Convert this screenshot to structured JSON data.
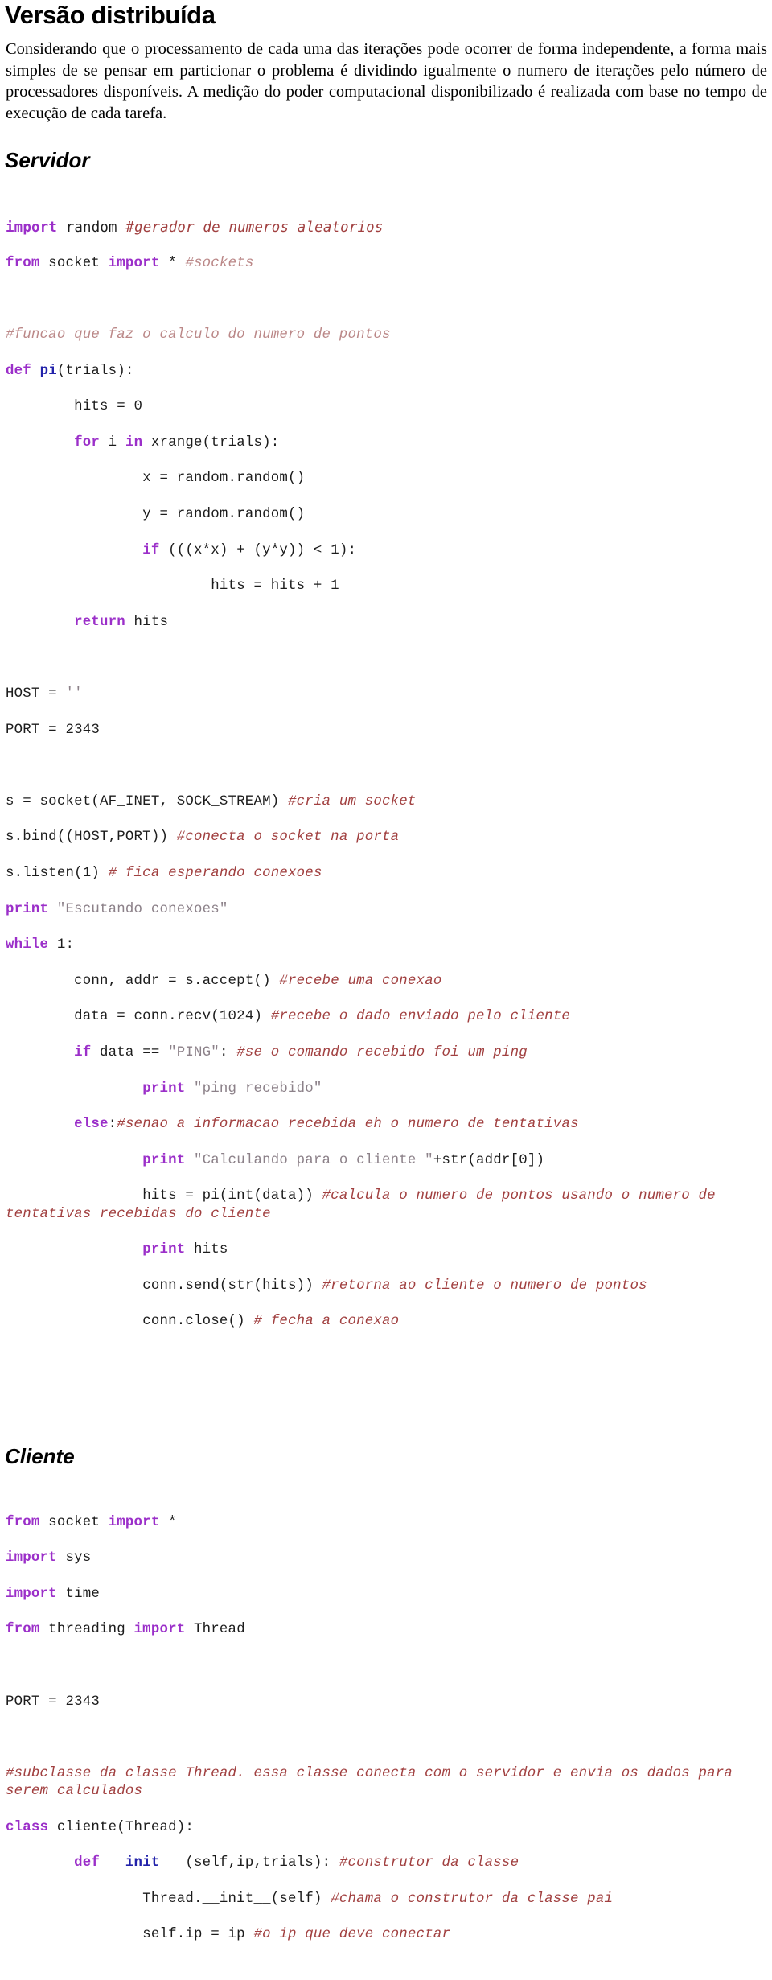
{
  "document": {
    "title": "Versão distribuída",
    "intro_paragraph": "Considerando que o processamento de cada uma das iterações pode ocorrer de forma independente, a forma mais simples de se pensar em particionar o problema é dividindo igualmente o numero de iterações pelo número de processadores disponíveis. A medição do poder computacional disponibilizado é realizada com base no tempo de execução de cada tarefa."
  },
  "sections": {
    "servidor": {
      "heading": "Servidor"
    },
    "cliente": {
      "heading": "Cliente"
    }
  },
  "code": {
    "servidor": {
      "l01_kw_import": "import",
      "l01_mod": " random ",
      "l01_comment": "#gerador de numeros aleatorios",
      "l02_kw_from": "from",
      "l02_mod": " socket ",
      "l02_kw_import": "import",
      "l02_star": " * ",
      "l02_comment": "#sockets",
      "l04_comment": "#funcao que faz o calculo do numero de pontos",
      "l05_kw_def": "def",
      "l05_name": "pi",
      "l05_rest": "(trials):",
      "l06": "        hits = 0",
      "l07_ind": "        ",
      "l07_kw_for": "for",
      "l07_mid": " i ",
      "l07_kw_in": "in",
      "l07_rest": " xrange(trials):",
      "l08": "                x = random.random()",
      "l09": "                y = random.random()",
      "l10_ind": "                ",
      "l10_kw_if": "if",
      "l10_rest": " (((x*x) + (y*y)) < 1):",
      "l11": "                        hits = hits + 1",
      "l12_ind": "        ",
      "l12_kw_return": "return",
      "l12_rest": " hits",
      "l14_pre": "HOST = ",
      "l14_str": "''",
      "l15": "PORT = 2343",
      "l17_pre": "s = socket(AF_INET, SOCK_STREAM) ",
      "l17_comment": "#cria um socket",
      "l18_pre": "s.bind((HOST,PORT)) ",
      "l18_comment": "#conecta o socket na porta",
      "l19_pre": "s.listen(1) ",
      "l19_comment": "# fica esperando conexoes",
      "l20_kw_print": "print",
      "l20_str": " \"Escutando conexoes\"",
      "l21_kw_while": "while",
      "l21_rest": " 1:",
      "l22_pre": "        conn, addr = s.accept() ",
      "l22_comment": "#recebe uma conexao",
      "l23_pre": "        data = conn.recv(1024) ",
      "l23_comment": "#recebe o dado enviado pelo cliente",
      "l24_ind": "        ",
      "l24_kw_if": "if",
      "l24_mid": " data == ",
      "l24_str": "\"PING\"",
      "l24_colon": ": ",
      "l24_comment": "#se o comando recebido foi um ping",
      "l25_ind": "                ",
      "l25_kw_print": "print",
      "l25_str": " \"ping recebido\"",
      "l26_ind": "        ",
      "l26_kw_else": "else",
      "l26_colon": ":",
      "l26_comment": "#senao a informacao recebida eh o numero de tentativas",
      "l27_ind": "                ",
      "l27_kw_print": "print",
      "l27_str": " \"Calculando para o cliente \"",
      "l27_rest": "+str(addr[0])",
      "l28_pre": "                hits = pi(int(data)) ",
      "l28_comment": "#calcula o numero de pontos usando o numero de tentativas recebidas do cliente",
      "l29_ind": "                ",
      "l29_kw_print": "print",
      "l29_rest": " hits",
      "l30_pre": "                conn.send(str(hits)) ",
      "l30_comment": "#retorna ao cliente o numero de pontos",
      "l31_pre": "                conn.close() ",
      "l31_comment": "# fecha a conexao"
    },
    "cliente": {
      "c01_kw_from": "from",
      "c01_mid": " socket ",
      "c01_kw_import": "import",
      "c01_rest": " *",
      "c02_kw_import": "import",
      "c02_rest": " sys",
      "c03_kw_import": "import",
      "c03_rest": " time",
      "c04_kw_from": "from",
      "c04_mid": " threading ",
      "c04_kw_import": "import",
      "c04_rest": " Thread",
      "c06": "PORT = 2343",
      "c08_comment": "#subclasse da classe Thread. essa classe conecta com o servidor e envia os dados para serem calculados",
      "c09_kw_class": "class",
      "c09_rest": " cliente(Thread):",
      "c10_ind": "        ",
      "c10_kw_def": "def",
      "c10_name": " __init__",
      "c10_rest": " (self,ip,trials): ",
      "c10_comment": "#construtor da classe",
      "c11_pre": "                Thread.__init__(self) ",
      "c11_comment": "#chama o construtor da classe pai",
      "c12_pre": "                self.ip = ip ",
      "c12_comment": "#o ip que deve conectar"
    }
  },
  "colors": {
    "keyword": "#9B2FC9",
    "function_name": "#2222AA",
    "comment": "#A14040",
    "comment_light": "#BB8888",
    "string": "#8C8189",
    "plain": "#1c1c1c",
    "background": "#FFFFFF"
  }
}
